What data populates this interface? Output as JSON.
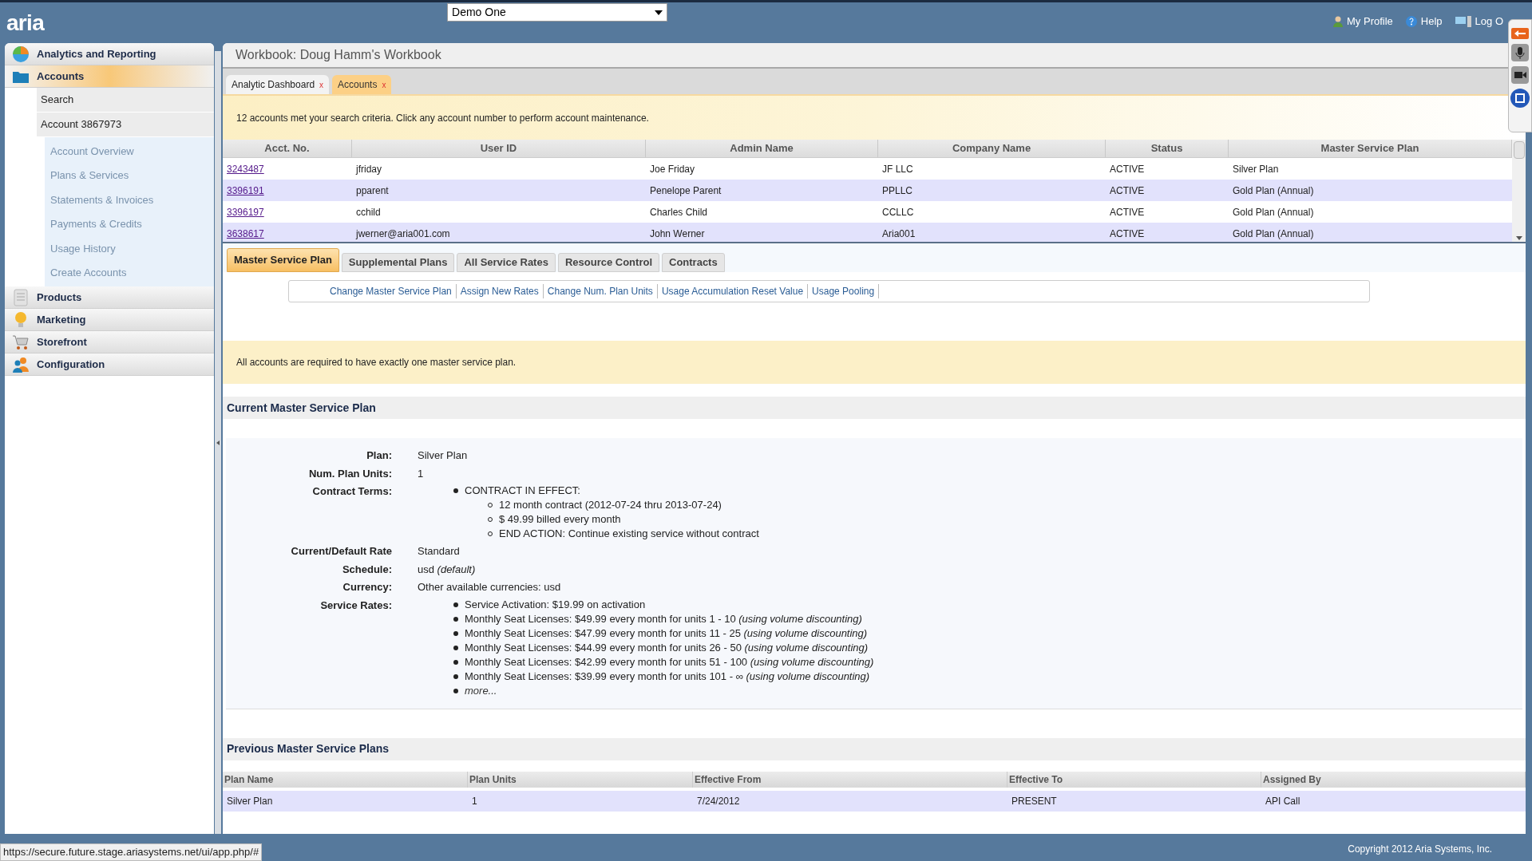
{
  "header": {
    "logo": "aria",
    "account_select": "Demo One",
    "links": [
      {
        "label": "My Profile"
      },
      {
        "label": "Help"
      },
      {
        "label": "Log O"
      }
    ]
  },
  "sidebar": {
    "sections": [
      {
        "label": "Analytics and Reporting",
        "selected": false
      },
      {
        "label": "Accounts",
        "selected": true,
        "children": [
          {
            "label": "Search"
          },
          {
            "label": "Account 3867973",
            "children": [
              {
                "label": "Account Overview"
              },
              {
                "label": "Plans & Services"
              },
              {
                "label": "Statements & Invoices"
              },
              {
                "label": "Payments & Credits"
              },
              {
                "label": "Usage History"
              },
              {
                "label": "Create Accounts"
              }
            ]
          }
        ]
      },
      {
        "label": "Products",
        "selected": false
      },
      {
        "label": "Marketing",
        "selected": false
      },
      {
        "label": "Storefront",
        "selected": false
      },
      {
        "label": "Configuration",
        "selected": false
      }
    ]
  },
  "workbook": {
    "title": "Workbook: Doug Hamm's Workbook",
    "tabs": [
      {
        "label": "Analytic Dashboard",
        "close": "x",
        "selected": false
      },
      {
        "label": "Accounts",
        "close": "x",
        "selected": true
      }
    ]
  },
  "search_notice": "12 accounts met your search criteria. Click any account number to perform account maintenance.",
  "accounts_table": {
    "columns": [
      "Acct. No.",
      "User ID",
      "Admin Name",
      "Company Name",
      "Status",
      "Master Service Plan"
    ],
    "rows": [
      {
        "cells": [
          "3243487",
          "jfriday",
          "Joe Friday",
          "JF LLC",
          "ACTIVE",
          "Silver Plan"
        ]
      },
      {
        "cells": [
          "3396191",
          "pparent",
          "Penelope Parent",
          "PPLLC",
          "ACTIVE",
          "Gold Plan (Annual)"
        ]
      },
      {
        "cells": [
          "3396197",
          "cchild",
          "Charles Child",
          "CCLLC",
          "ACTIVE",
          "Gold Plan (Annual)"
        ]
      },
      {
        "cells": [
          "3638617",
          "jwerner@aria001.com",
          "John Werner",
          "Aria001",
          "ACTIVE",
          "Gold Plan (Annual)"
        ]
      }
    ]
  },
  "plan_tabs": [
    {
      "label": "Master Service Plan",
      "selected": true
    },
    {
      "label": "Supplemental Plans",
      "selected": false
    },
    {
      "label": "All Service Rates",
      "selected": false
    },
    {
      "label": "Resource Control",
      "selected": false
    },
    {
      "label": "Contracts",
      "selected": false
    }
  ],
  "actions": [
    "Change Master Service Plan",
    "Assign New Rates",
    "Change Num. Plan Units",
    "Usage Accumulation Reset Value",
    "Usage Pooling"
  ],
  "plan_notice": "All accounts are required to have exactly one master service plan.",
  "current_plan": {
    "title": "Current Master Service Plan",
    "fields": [
      {
        "label": "Plan:",
        "kind": "text",
        "value": "Silver Plan"
      },
      {
        "label": "Num. Plan Units:",
        "kind": "text",
        "value": "1"
      },
      {
        "label": "Contract Terms:",
        "kind": "list",
        "items": [
          {
            "text": "CONTRACT IN EFFECT:",
            "children": [
              {
                "text": "12 month contract (2012-07-24 thru 2013-07-24)"
              },
              {
                "text": "$ 49.99 billed every month"
              },
              {
                "text": "END ACTION: Continue existing service without contract"
              }
            ]
          }
        ]
      },
      {
        "label": "Current/Default Rate",
        "kind": "text",
        "value": "Standard"
      },
      {
        "label": "Schedule:",
        "kind": "text",
        "value": "usd *(default)*"
      },
      {
        "label": "Currency:",
        "kind": "text",
        "value": "Other available currencies: usd"
      },
      {
        "label": "Service Rates:",
        "kind": "list",
        "items": [
          {
            "text": "Service Activation: $19.99 on activation"
          },
          {
            "text": "Monthly Seat Licenses: $49.99 every month for units 1 - 10 *(using volume discounting)*"
          },
          {
            "text": "Monthly Seat Licenses: $47.99 every month for units 11 - 25 *(using volume discounting)*"
          },
          {
            "text": "Monthly Seat Licenses: $44.99 every month for units 26 - 50 *(using volume discounting)*"
          },
          {
            "text": "Monthly Seat Licenses: $42.99 every month for units 51 - 100 *(using volume discounting)*"
          },
          {
            "text": "Monthly Seat Licenses: $39.99 every month for units 101 - ∞ *(using volume discounting)*"
          },
          {
            "text": "more...",
            "kind": "link"
          }
        ]
      }
    ]
  },
  "previous_plans": {
    "title": "Previous Master Service Plans",
    "columns": [
      "Plan Name",
      "Plan Units",
      "Effective From",
      "Effective To",
      "Assigned By"
    ],
    "rows": [
      {
        "cells": [
          "Silver Plan",
          "1",
          "7/24/2012",
          "PRESENT",
          "API Call"
        ]
      }
    ]
  },
  "status_url": "https://secure.future.stage.ariasystems.net/ui/app.php/#",
  "copyright": "Copyright 2012 Aria Systems, Inc."
}
